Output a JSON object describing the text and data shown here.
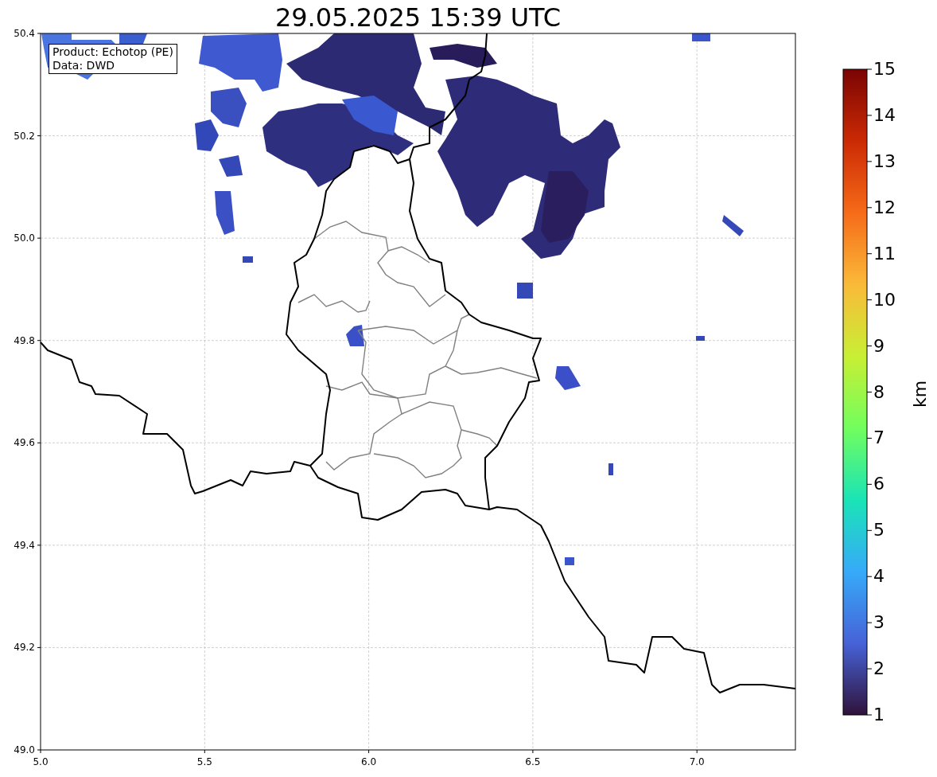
{
  "title": "29.05.2025 15:39 UTC",
  "info_box": [
    "Product: Echotop (PE)",
    "Data: DWD"
  ],
  "map": {
    "x_ticks": [
      "5.0",
      "5.5",
      "6.0",
      "6.5",
      "7.0"
    ],
    "y_ticks": [
      "50.4",
      "50.2",
      "50.0",
      "49.8",
      "49.6",
      "49.4",
      "49.2",
      "49.0"
    ]
  },
  "colorbar": {
    "label": "km",
    "ticks": [
      "15",
      "14",
      "13",
      "12",
      "11",
      "10",
      "9",
      "8",
      "7",
      "6",
      "5",
      "4",
      "3",
      "2",
      "1"
    ]
  }
}
